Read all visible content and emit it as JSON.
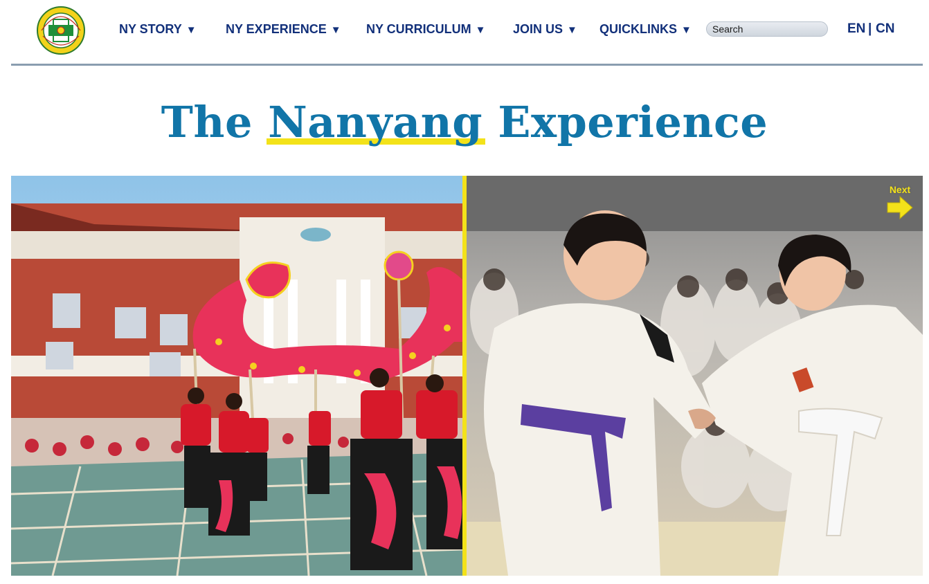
{
  "header": {
    "logo_name": "Nanyang Girls' High School crest",
    "nav": [
      {
        "label": "NY STORY",
        "caret": "▼"
      },
      {
        "label": "NY EXPERIENCE",
        "caret": "▼"
      },
      {
        "label": "NY CURRICULUM",
        "caret": "▼"
      },
      {
        "label": "JOIN US",
        "caret": "▼"
      },
      {
        "label": "QUICKLINKS",
        "caret": "▼"
      }
    ],
    "search_placeholder": "Search",
    "lang_en": "EN",
    "lang_sep": "|",
    "lang_cn": "CN"
  },
  "hero": {
    "title_pre": "The",
    "title_highlight": "Nanyang",
    "title_post": "Experience"
  },
  "gallery": {
    "left_photo": "Dragon dance performance in school courtyard",
    "right_photo": "Judo match between two students",
    "next_label": "Next",
    "next_icon": "arrow-right-icon"
  },
  "colors": {
    "nav_text": "#12307a",
    "title": "#1175a8",
    "accent_yellow": "#f3e21a",
    "rule": "#8a9db0"
  }
}
